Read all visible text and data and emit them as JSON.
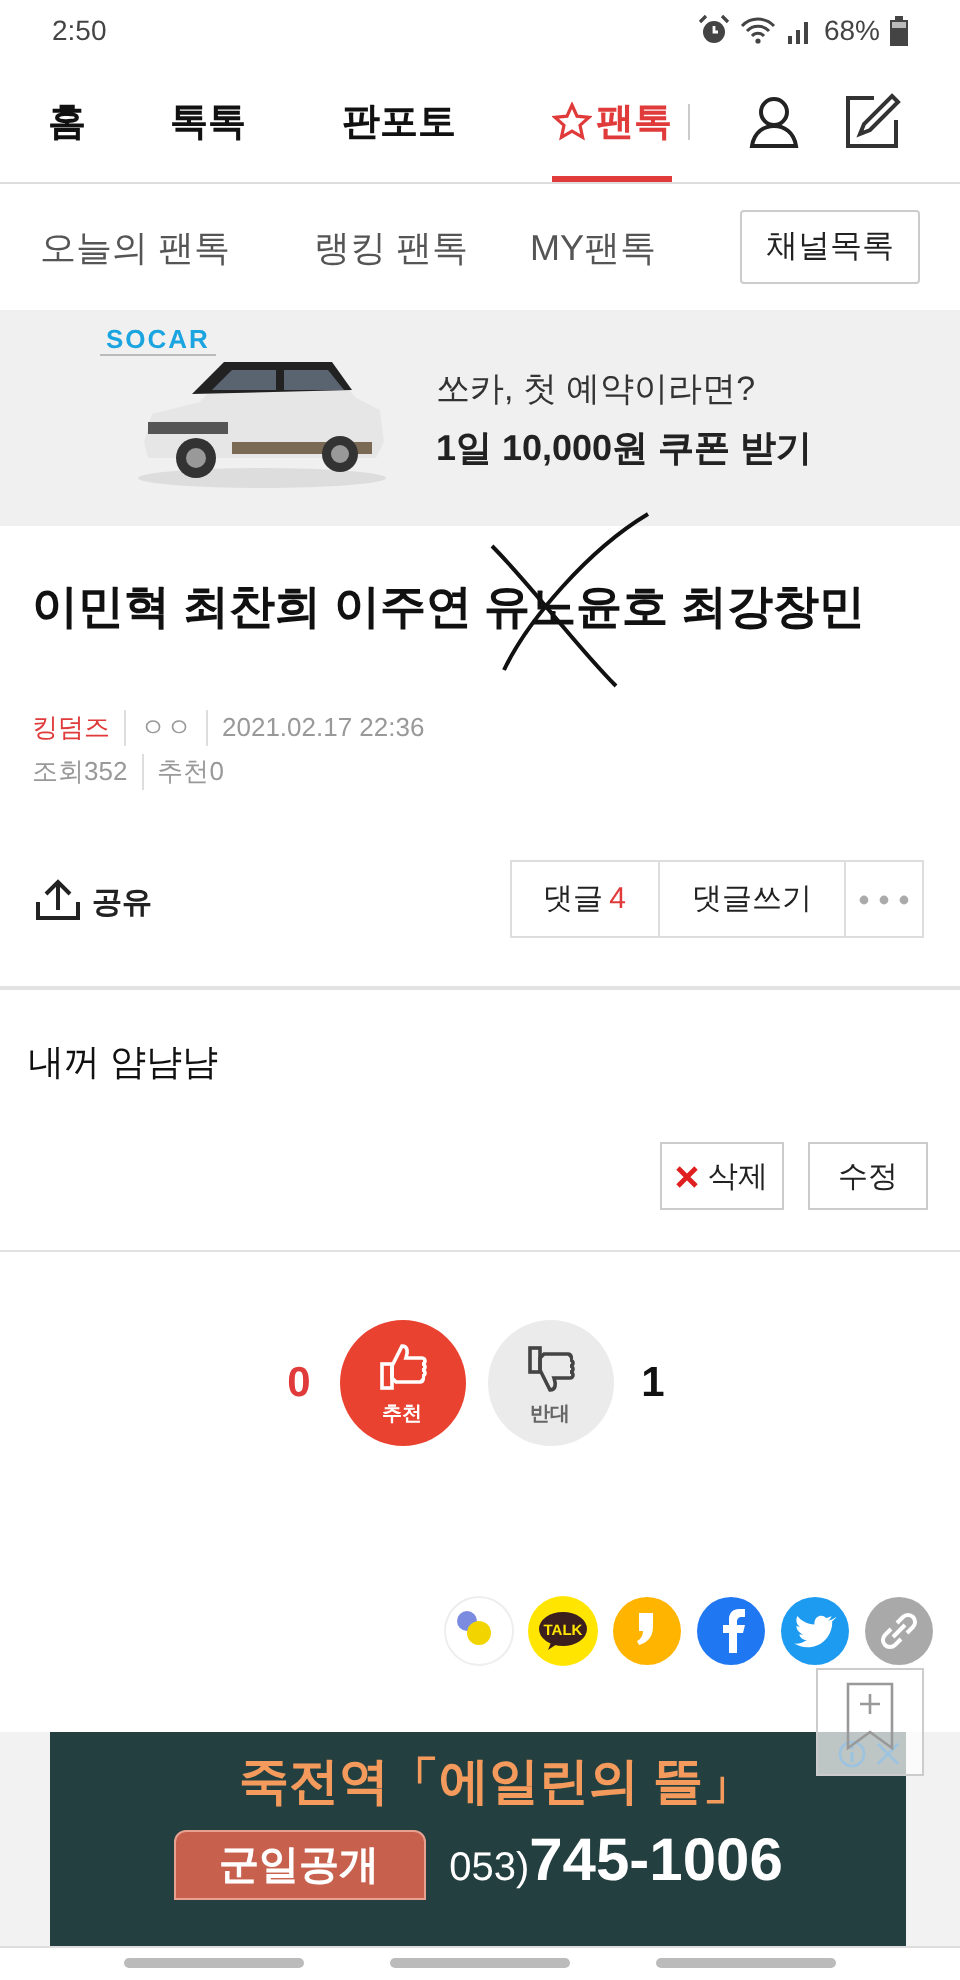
{
  "status_bar": {
    "time": "2:50",
    "battery": "68%"
  },
  "top_nav": {
    "tabs": [
      {
        "label": "홈",
        "selected": false,
        "star": false
      },
      {
        "label": "톡톡",
        "selected": false,
        "star": false
      },
      {
        "label": "판포토",
        "selected": false,
        "star": false
      },
      {
        "label": "팬톡",
        "selected": true,
        "star": true
      }
    ]
  },
  "sub_nav": {
    "items": [
      "오늘의 팬톡",
      "랭킹 팬톡",
      "MY팬톡"
    ],
    "channel_button": "채널목록"
  },
  "ad_banner": {
    "brand": "SOCAR",
    "line_1": "쏘카, 첫 예약이라면?",
    "line_2": "1일 10,000원 쿠폰 받기"
  },
  "post": {
    "title": "이민혁 최찬희 이주연 유노윤호 최강창민",
    "crossed_out": true,
    "author": "킹덤즈",
    "nickname": "ㅇㅇ",
    "date": "2021.02.17 22:36",
    "views": "조회352",
    "recommends": "추천0"
  },
  "actions": {
    "share": "공유",
    "comments": "댓글",
    "comment_count": "4",
    "write_comment": "댓글쓰기"
  },
  "comment": {
    "text": "내꺼 얌냠냠",
    "delete": "삭제",
    "edit": "수정"
  },
  "vote": {
    "up_count": "0",
    "up_label": "추천",
    "down_label": "반대",
    "down_count": "1"
  },
  "share_buttons": [
    {
      "kind": "band"
    },
    {
      "kind": "kakaotalk",
      "label": "TALK"
    },
    {
      "kind": "kakaostory"
    },
    {
      "kind": "facebook"
    },
    {
      "kind": "twitter"
    },
    {
      "kind": "link"
    }
  ],
  "bottom_ad": {
    "headline": "죽전역「에일린의 뜰」",
    "badge": "군일공개",
    "phone_prefix": "053)",
    "phone": "745-1006"
  }
}
